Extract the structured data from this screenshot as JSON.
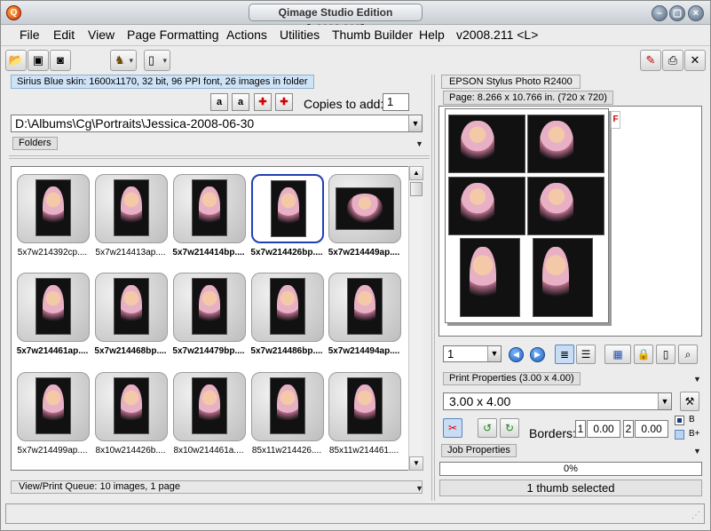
{
  "window": {
    "title": "Qimage Studio Edition [v2008.210]"
  },
  "menu": [
    "File",
    "Edit",
    "View",
    "Page Formatting",
    "Actions",
    "Utilities",
    "Thumb Builder",
    "Help",
    "v2008.211 <L>"
  ],
  "toolbar": {
    "icons": [
      "open-folder-icon",
      "save-icon",
      "camera-icon",
      "filter-icon",
      "new-page-icon",
      "edit-icon",
      "print-icon",
      "exit-icon"
    ]
  },
  "left": {
    "skin_info": "Sirius Blue skin: 1600x1170, 32 bit, 96 PPI font, 26 images in folder",
    "copies_label": "Copies to add:",
    "copies_value": "1",
    "folder_path": "D:\\Albums\\Cg\\Portraits\\Jessica-2008-06-30",
    "folders_label": "Folders",
    "queue_status": "View/Print Queue: 10 images, 1 page"
  },
  "thumbnails": [
    {
      "label": "5x7w214392cp....",
      "bold": false,
      "selected": false
    },
    {
      "label": "5x7w214413ap....",
      "bold": false,
      "selected": false
    },
    {
      "label": "5x7w214414bp....",
      "bold": true,
      "selected": false
    },
    {
      "label": "5x7w214426bp....",
      "bold": true,
      "selected": true
    },
    {
      "label": "5x7w214449ap....",
      "bold": true,
      "selected": false
    },
    {
      "label": "5x7w214461ap....",
      "bold": true,
      "selected": false
    },
    {
      "label": "5x7w214468bp....",
      "bold": true,
      "selected": false
    },
    {
      "label": "5x7w214479bp....",
      "bold": true,
      "selected": false
    },
    {
      "label": "5x7w214486bp....",
      "bold": true,
      "selected": false
    },
    {
      "label": "5x7w214494ap....",
      "bold": true,
      "selected": false
    },
    {
      "label": "5x7w214499ap....",
      "bold": false,
      "selected": false
    },
    {
      "label": "8x10w214426b....",
      "bold": false,
      "selected": false
    },
    {
      "label": "8x10w214461a....",
      "bold": false,
      "selected": false
    },
    {
      "label": "85x11w214426....",
      "bold": false,
      "selected": false
    },
    {
      "label": "85x11w214461....",
      "bold": false,
      "selected": false
    }
  ],
  "right": {
    "printer": "EPSON Stylus Photo R2400",
    "page_info": "Page: 8.266 x 10.766 in.  (720 x 720)",
    "page_number": "1",
    "print_properties": "Print Properties (3.00 x 4.00)",
    "print_size": "3.00 x 4.00",
    "borders_label": "Borders:",
    "border_1_num": "1",
    "border_1_val": "0.00",
    "border_2_num": "2",
    "border_2_val": "0.00",
    "radio_b": "B",
    "radio_bplus": "B+",
    "job_properties": "Job Properties",
    "progress": "0%",
    "selection_status": "1 thumb selected",
    "flag": "F"
  }
}
